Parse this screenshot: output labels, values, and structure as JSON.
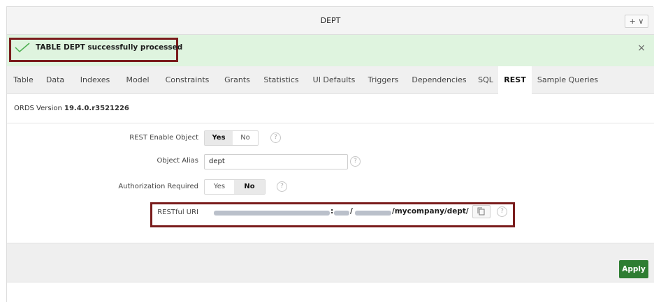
{
  "header": {
    "title": "DEPT",
    "menu_button_label": "+ ∨"
  },
  "notification": {
    "message": "TABLE DEPT successfully processed",
    "close_label": "×"
  },
  "tabs": [
    {
      "label": "Table",
      "active": false
    },
    {
      "label": "Data",
      "active": false
    },
    {
      "label": "Indexes",
      "active": false
    },
    {
      "label": "Model",
      "active": false
    },
    {
      "label": "Constraints",
      "active": false
    },
    {
      "label": "Grants",
      "active": false
    },
    {
      "label": "Statistics",
      "active": false
    },
    {
      "label": "UI Defaults",
      "active": false
    },
    {
      "label": "Triggers",
      "active": false
    },
    {
      "label": "Dependencies",
      "active": false
    },
    {
      "label": "SQL",
      "active": false
    },
    {
      "label": "REST",
      "active": true
    },
    {
      "label": "Sample Queries",
      "active": false
    }
  ],
  "ords": {
    "prefix": "ORDS Version ",
    "version": "19.4.0.r3521226"
  },
  "form": {
    "rest_enable": {
      "label": "REST Enable Object",
      "options": [
        "Yes",
        "No"
      ],
      "selected": "Yes"
    },
    "alias": {
      "label": "Object Alias",
      "value": "dept"
    },
    "auth": {
      "label": "Authorization Required",
      "options": [
        "Yes",
        "No"
      ],
      "selected": "No"
    },
    "uri": {
      "label": "RESTful URI",
      "colon": ":",
      "slash": "/",
      "path": "/mycompany/dept/"
    },
    "help_glyph": "?"
  },
  "footer": {
    "apply_label": "Apply"
  },
  "colors": {
    "success_bg": "#dff4df",
    "apply_bg": "#2e7d32",
    "highlight_border": "#7a1c1c"
  }
}
